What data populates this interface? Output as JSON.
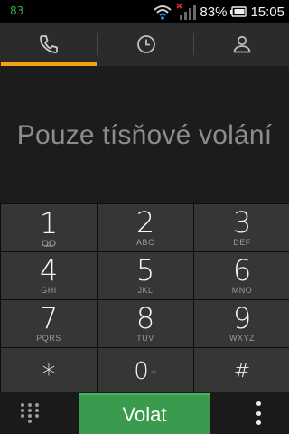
{
  "status_bar": {
    "notification_count": "83",
    "battery_percent": "83%",
    "time": "15:05"
  },
  "tabs": [
    {
      "name": "dialer",
      "icon": "phone-icon",
      "active": true
    },
    {
      "name": "call-log",
      "icon": "clock-icon",
      "active": false
    },
    {
      "name": "contacts",
      "icon": "person-icon",
      "active": false
    }
  ],
  "display": {
    "text": "Pouze tísňové volání"
  },
  "keypad": {
    "keys": [
      {
        "digit": "1",
        "letters": "",
        "icon": "voicemail-icon"
      },
      {
        "digit": "2",
        "letters": "ABC"
      },
      {
        "digit": "3",
        "letters": "DEF"
      },
      {
        "digit": "4",
        "letters": "GHI"
      },
      {
        "digit": "5",
        "letters": "JKL"
      },
      {
        "digit": "6",
        "letters": "MNO"
      },
      {
        "digit": "7",
        "letters": "PQRS"
      },
      {
        "digit": "8",
        "letters": "TUV"
      },
      {
        "digit": "9",
        "letters": "WXYZ"
      },
      {
        "digit": "*",
        "letters": ""
      },
      {
        "digit": "0",
        "letters": "+"
      },
      {
        "digit": "#",
        "letters": ""
      }
    ]
  },
  "bottom_bar": {
    "dialpad_icon": "dialpad-grid-icon",
    "call_label": "Volat",
    "menu_icon": "overflow-menu-icon"
  },
  "colors": {
    "accent": "#f0a414",
    "call_green": "#3a9a4e",
    "status_green": "#3ea84a"
  }
}
